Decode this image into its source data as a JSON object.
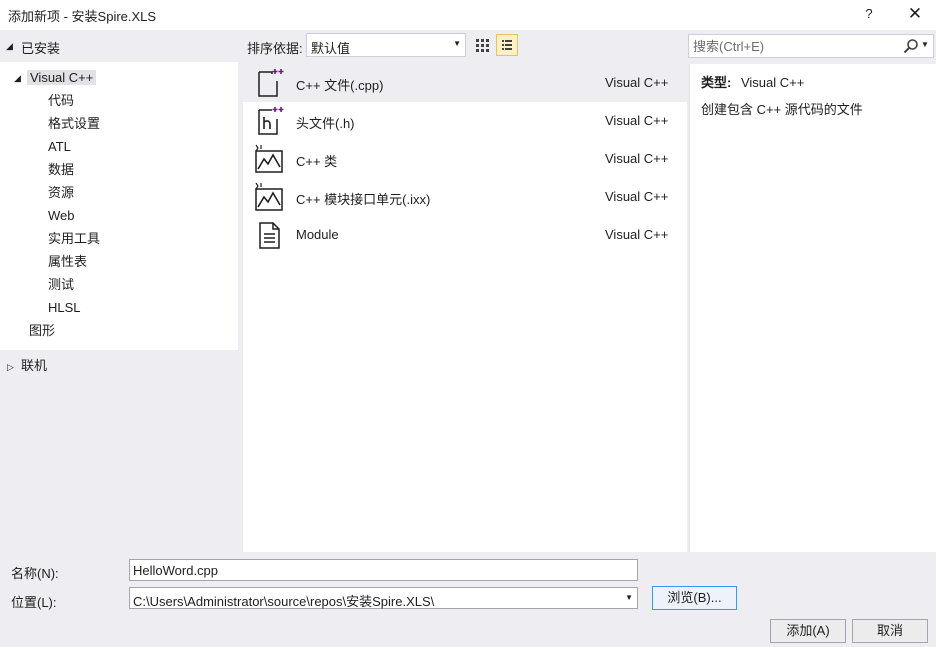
{
  "window": {
    "title": "添加新项 - 安装Spire.XLS",
    "help_label": "?",
    "close_label": "✕"
  },
  "tree": {
    "installed_label": "已安装",
    "visual_cpp_label": "Visual C++",
    "children": [
      "代码",
      "格式设置",
      "ATL",
      "数据",
      "资源",
      "Web",
      "实用工具",
      "属性表",
      "测试",
      "HLSL"
    ],
    "graphics_label": "图形",
    "online_label": "联机"
  },
  "toolbar": {
    "sort_label": "排序依据:",
    "sort_value": "默认值",
    "grid_view_icon": "grid-view-icon",
    "list_view_icon": "list-view-icon"
  },
  "search": {
    "placeholder": "搜索(Ctrl+E)"
  },
  "templates": [
    {
      "name": "C++ 文件(.cpp)",
      "type": "Visual C++",
      "icon": "cpp-file-icon",
      "selected": true
    },
    {
      "name": "头文件(.h)",
      "type": "Visual C++",
      "icon": "header-file-icon",
      "selected": false
    },
    {
      "name": "C++ 类",
      "type": "Visual C++",
      "icon": "cpp-class-icon",
      "selected": false
    },
    {
      "name": "C++ 模块接口单元(.ixx)",
      "type": "Visual C++",
      "icon": "module-interface-icon",
      "selected": false
    },
    {
      "name": "Module",
      "type": "Visual C++",
      "icon": "module-file-icon",
      "selected": false
    }
  ],
  "details": {
    "type_label": "类型:",
    "type_value": "Visual C++",
    "description": "创建包含 C++ 源代码的文件"
  },
  "form": {
    "name_label": "名称(N):",
    "name_value": "HelloWord.cpp",
    "location_label": "位置(L):",
    "location_value": "C:\\Users\\Administrator\\source\\repos\\安装Spire.XLS\\",
    "browse_label": "浏览(B)..."
  },
  "buttons": {
    "add_label": "添加(A)",
    "cancel_label": "取消"
  },
  "colors": {
    "panel_bg": "#eeeef2",
    "selected_row": "#eeeef2",
    "accent_purple": "#68217a",
    "browse_border": "#3399ff"
  }
}
